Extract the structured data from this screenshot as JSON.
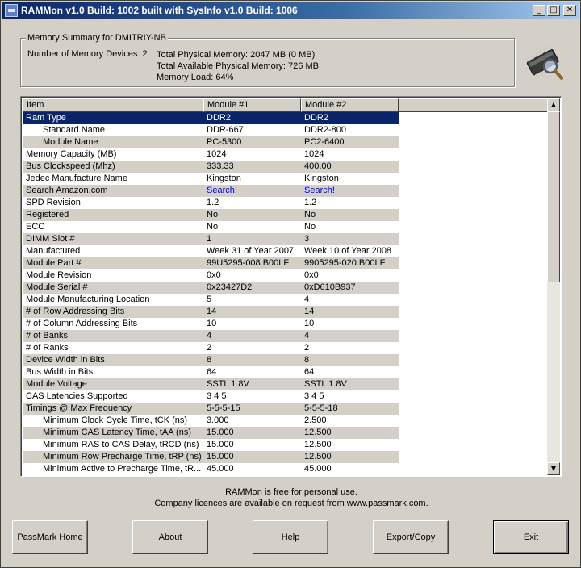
{
  "window": {
    "title": "RAMMon v1.0 Build: 1002 built with SysInfo v1.0 Build: 1006",
    "controls": {
      "minimize": "_",
      "maximize": "□",
      "close": "✕"
    }
  },
  "summary": {
    "legend": "Memory Summary for DMITRIY-NB",
    "devices": "Number of Memory Devices: 2",
    "total_physical": "Total Physical Memory: 2047 MB (0 MB)",
    "total_available": "Total Available Physical Memory: 726 MB",
    "memory_load": "Memory Load: 64%"
  },
  "table": {
    "headers": [
      "Item",
      "Module #1",
      "Module #2"
    ],
    "rows": [
      {
        "item": "Ram Type",
        "m1": "DDR2",
        "m2": "DDR2",
        "indent": false,
        "selected": true
      },
      {
        "item": "Standard Name",
        "m1": "DDR-667",
        "m2": "DDR2-800",
        "indent": true
      },
      {
        "item": "Module Name",
        "m1": "PC-5300",
        "m2": "PC2-6400",
        "indent": true
      },
      {
        "item": "Memory Capacity (MB)",
        "m1": "1024",
        "m2": "1024",
        "indent": false
      },
      {
        "item": "Bus Clockspeed (Mhz)",
        "m1": "333.33",
        "m2": "400.00",
        "indent": false
      },
      {
        "item": "Jedec Manufacture Name",
        "m1": "Kingston",
        "m2": "Kingston",
        "indent": false
      },
      {
        "item": "Search Amazon.com",
        "m1": "Search!",
        "m2": "Search!",
        "indent": false,
        "link": true
      },
      {
        "item": "SPD Revision",
        "m1": "1.2",
        "m2": "1.2",
        "indent": false
      },
      {
        "item": "Registered",
        "m1": "No",
        "m2": "No",
        "indent": false
      },
      {
        "item": "ECC",
        "m1": "No",
        "m2": "No",
        "indent": false
      },
      {
        "item": "DIMM Slot #",
        "m1": "1",
        "m2": "3",
        "indent": false
      },
      {
        "item": "Manufactured",
        "m1": "Week 31 of Year 2007",
        "m2": "Week 10 of Year 2008",
        "indent": false
      },
      {
        "item": "Module Part #",
        "m1": "99U5295-008.B00LF",
        "m2": "9905295-020.B00LF",
        "indent": false
      },
      {
        "item": "Module Revision",
        "m1": "0x0",
        "m2": "0x0",
        "indent": false
      },
      {
        "item": "Module Serial #",
        "m1": "0x23427D2",
        "m2": "0xD610B937",
        "indent": false
      },
      {
        "item": "Module Manufacturing Location",
        "m1": "5",
        "m2": "4",
        "indent": false
      },
      {
        "item": "# of Row Addressing Bits",
        "m1": "14",
        "m2": "14",
        "indent": false
      },
      {
        "item": "# of Column Addressing Bits",
        "m1": "10",
        "m2": "10",
        "indent": false
      },
      {
        "item": "# of Banks",
        "m1": "4",
        "m2": "4",
        "indent": false
      },
      {
        "item": "# of Ranks",
        "m1": "2",
        "m2": "2",
        "indent": false
      },
      {
        "item": "Device Width in Bits",
        "m1": "8",
        "m2": "8",
        "indent": false
      },
      {
        "item": "Bus Width in Bits",
        "m1": "64",
        "m2": "64",
        "indent": false
      },
      {
        "item": "Module Voltage",
        "m1": "SSTL 1.8V",
        "m2": "SSTL 1.8V",
        "indent": false
      },
      {
        "item": "CAS Latencies Supported",
        "m1": "3 4 5",
        "m2": "3 4 5",
        "indent": false
      },
      {
        "item": "Timings @ Max Frequency",
        "m1": "5-5-5-15",
        "m2": "5-5-5-18",
        "indent": false
      },
      {
        "item": "Minimum Clock Cycle Time, tCK (ns)",
        "m1": "3.000",
        "m2": "2.500",
        "indent": true
      },
      {
        "item": "Minimum CAS Latency Time, tAA (ns)",
        "m1": "15.000",
        "m2": "12.500",
        "indent": true
      },
      {
        "item": "Minimum RAS to CAS Delay, tRCD (ns)",
        "m1": "15.000",
        "m2": "12.500",
        "indent": true
      },
      {
        "item": "Minimum Row Precharge Time, tRP (ns)",
        "m1": "15.000",
        "m2": "12.500",
        "indent": true
      },
      {
        "item": "Minimum Active to Precharge Time, tR...",
        "m1": "45.000",
        "m2": "45.000",
        "indent": true
      }
    ]
  },
  "scrollbar": {
    "up": "▲",
    "down": "▼"
  },
  "footer": {
    "line1": "RAMMon is free for personal use.",
    "line2": "Company licences are available on request from www.passmark.com."
  },
  "buttons": {
    "passmark_home": "PassMark Home",
    "about": "About",
    "help": "Help",
    "export_copy": "Export/Copy",
    "exit": "Exit"
  }
}
